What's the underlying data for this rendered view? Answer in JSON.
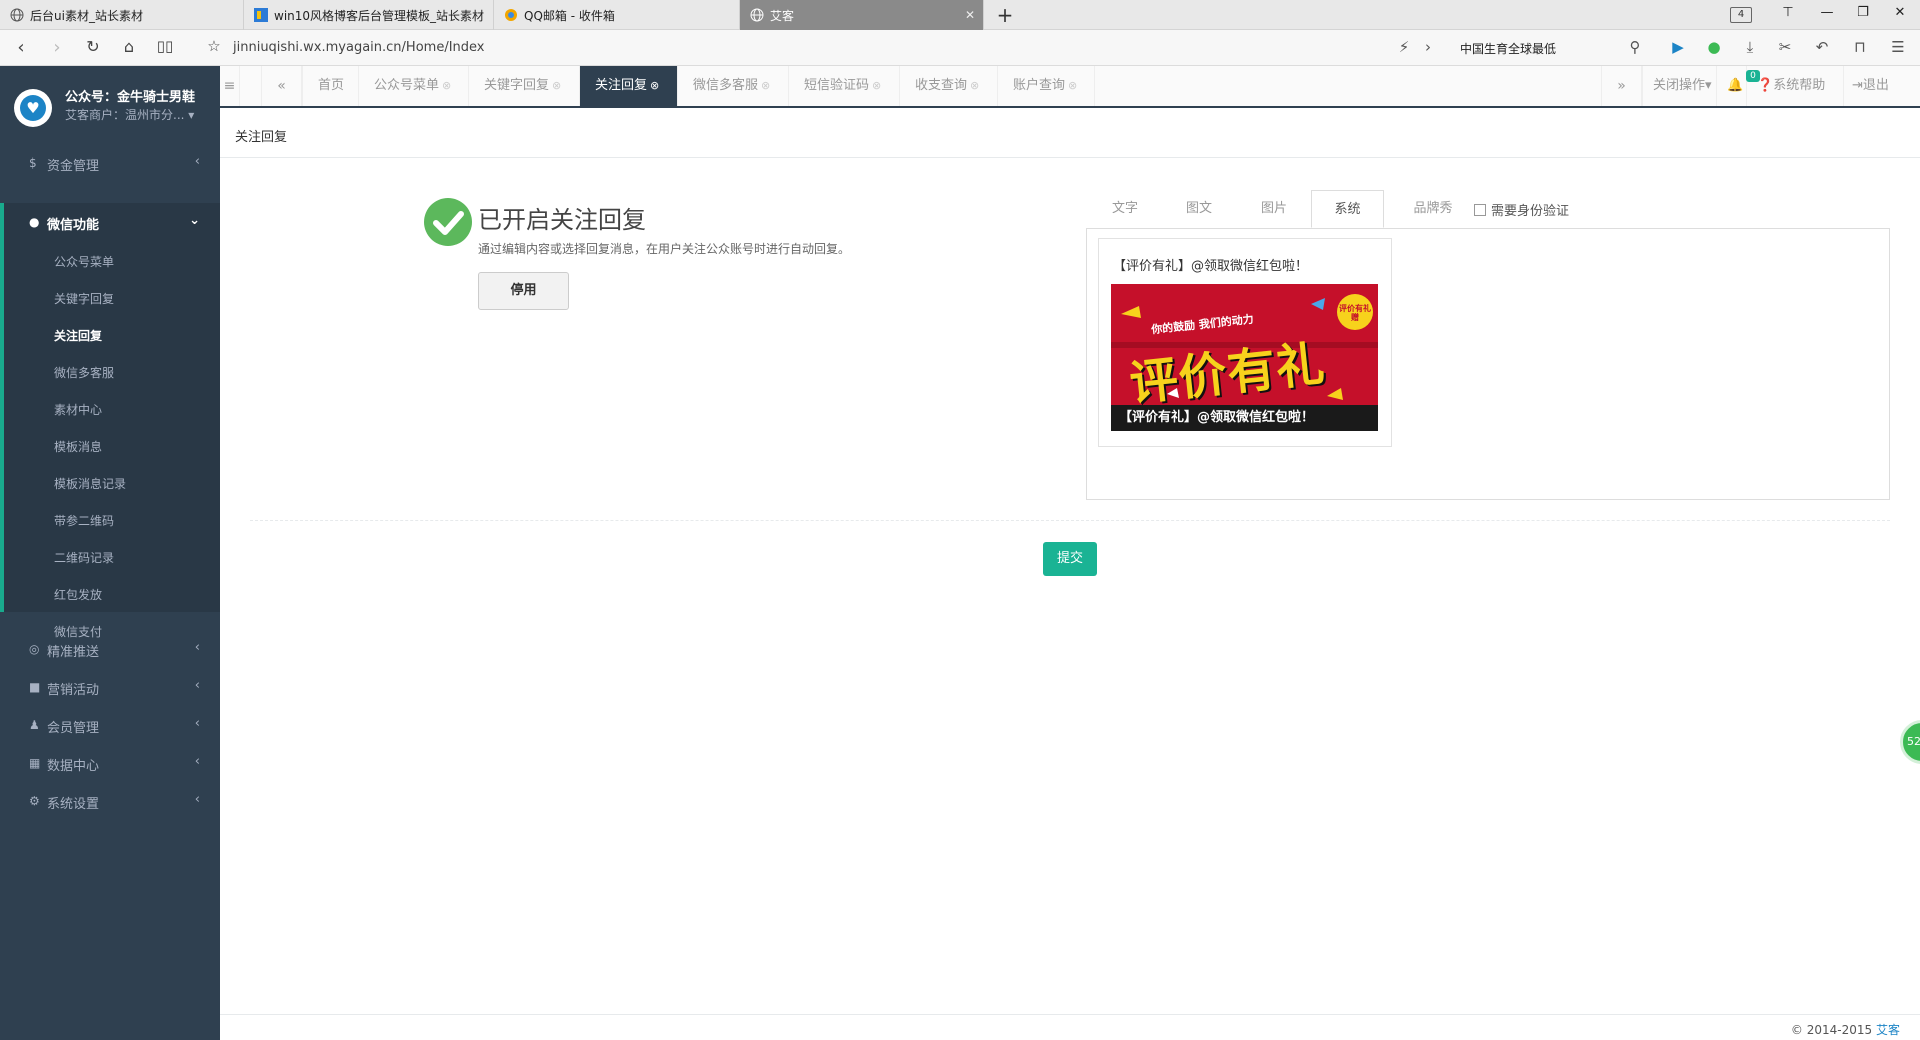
{
  "browser": {
    "tabs": [
      {
        "title": "后台ui素材_站长素材"
      },
      {
        "title": "win10风格博客后台管理模板_站长素材"
      },
      {
        "title": "QQ邮箱 - 收件箱"
      },
      {
        "title": "艾客"
      }
    ],
    "tab_count": "4",
    "url": "jinniuqishi.wx.myagain.cn/Home/Index",
    "search_text": "中国生育全球最低"
  },
  "sidebar": {
    "account_name": "公众号：金牛骑士男鞋",
    "merchant": "艾客商户：温州市分...",
    "menus": [
      {
        "label": "资金管理",
        "icon": "$"
      },
      {
        "label": "微信功能",
        "icon": "●"
      },
      {
        "label": "精准推送",
        "icon": "◎"
      },
      {
        "label": "营销活动",
        "icon": "■"
      },
      {
        "label": "会员管理",
        "icon": "♟"
      },
      {
        "label": "数据中心",
        "icon": "▦"
      },
      {
        "label": "系统设置",
        "icon": "⚙"
      }
    ],
    "wechat_sub": [
      "公众号菜单",
      "关键字回复",
      "关注回复",
      "微信多客服",
      "素材中心",
      "模板消息",
      "模板消息记录",
      "带参二维码",
      "二维码记录",
      "红包发放",
      "微信支付"
    ]
  },
  "content_tabs": {
    "home": "首页",
    "tabs": [
      "公众号菜单",
      "关键字回复",
      "关注回复",
      "微信多客服",
      "短信验证码",
      "收支查询",
      "账户查询"
    ],
    "close_ops": "关闭操作",
    "notif_count": "0",
    "help": "系统帮助",
    "logout": "退出"
  },
  "breadcrumb": "关注回复",
  "status": {
    "title": "已开启关注回复",
    "desc": "通过编辑内容或选择回复消息，在用户关注公众账号时进行自动回复。",
    "disable_label": "停用"
  },
  "reply_tabs": [
    "文字",
    "图文",
    "图片",
    "系统",
    "品牌秀"
  ],
  "need_verify_label": "需要身份验证",
  "reply_card": {
    "title": "【评价有礼】@领取微信红包啦！",
    "banner_sub": "你的鼓励 我们的动力",
    "banner_main": "评价有礼",
    "banner_seal": "评价有礼赠",
    "banner_strip": "【评价有礼】@领取微信红包啦！"
  },
  "submit_label": "提交",
  "float_badge": "52",
  "footer": {
    "copyright": "© 2014-2015",
    "link": "艾客"
  },
  "colors": {
    "sidebar": "#2f4050",
    "accent": "#1ab394",
    "check": "#5cb85c"
  }
}
